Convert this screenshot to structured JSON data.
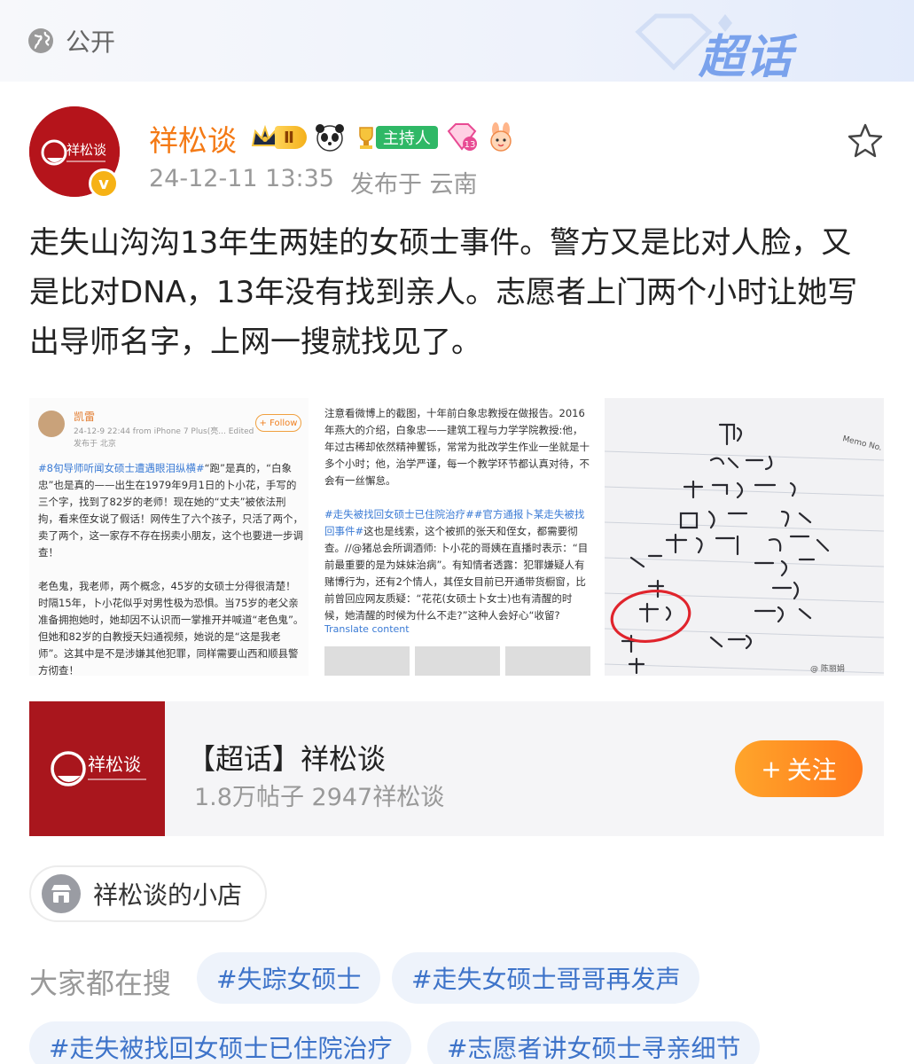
{
  "header": {
    "visibility_label": "公开",
    "supertopic_brand": "超话"
  },
  "author": {
    "name": "祥松谈",
    "level_badge": "Ⅱ",
    "host_badge": "主持人",
    "gem_level": "13",
    "timestamp": "24-12-11 13:35",
    "published_from": "发布于 云南",
    "avatar_text": "祥松谈"
  },
  "post": {
    "text": "走失山沟沟13年生两娃的女硕士事件。警方又是比对人脸，又是比对DNA，13年没有找到亲人。志愿者上门两个小时让她写出导师名字，上网一搜就找见了。"
  },
  "images": {
    "img1": {
      "name": "凯雷",
      "time": "24-12-9 22:44  from iPhone 7 Plus(亮...  Edited",
      "location": "发布于 北京",
      "follow_label": "+ Follow",
      "tag": "#8旬导师听闻女硕士遭遇眼泪纵横#",
      "para1": "“跑”是真的，“白象忠”也是真的——出生在1979年9月1日的卜小花，手写的三个字，找到了82岁的老师！现在她的“丈夫”被依法刑拘，看来侄女说了假话！网传生了六个孩子，只活了两个，卖了两个，这一家存不存在拐卖小朋友，这个也要进一步调查！",
      "para2": "老色鬼，我老师，两个概念，45岁的女硕士分得很清楚！时隔15年，卜小花似乎对男性极为恐惧。当75岁的老父亲准备拥抱她时，她却因不认识而一掌推开并喊道“老色鬼”。但她和82岁的白教授天妇通视频，她说的是“这是我老师”。这其中是不是涉嫌其他犯罪，同样需要山西和顺县警方彻查！"
    },
    "img2": {
      "para1": "注意看微博上的截图，十年前白象忠教授在做报告。2016年燕大的介绍，白象忠——建筑工程与力学学院教授:他，年过古稀却依然精神矍铄，常常为批改学生作业一坐就是十多个小时；他，治学严谨，每一个教学环节都认真对待，不会有一丝懈怠。",
      "tags": "#走失被找回女硕士已住院治疗##官方通报卜某走失被找回事件#",
      "para2": "这也是线索，这个被抓的张天和侄女，都需要彻查。//@猪总会所调酒师: 卜小花的哥姨在直播时表示：“目前最重要的是为妹妹治病”。有知情者透露：犯罪嫌疑人有赌博行为，还有2个情人，其侄女目前已开通带货橱窗，比前曾回应网友质疑：“花花(女硕士卜女士)也有清醒的时候，她清醒的时候为什么不走?”这种人会好心“收留?",
      "translate": "Translate content"
    },
    "img3": {
      "note_label": "Memo No. Date",
      "watermark": "@ 陈丽娟"
    }
  },
  "topic_card": {
    "title": "【超话】祥松谈",
    "stats": "1.8万帖子  2947祥松谈",
    "follow_label": "关注",
    "follow_plus": "+"
  },
  "shop": {
    "label": "祥松谈的小店"
  },
  "trending": {
    "label": "大家都在搜",
    "chips": [
      "#失踪女硕士",
      "#走失女硕士哥哥再发声",
      "#走失被找回女硕士已住院治疗",
      "#志愿者讲女硕士寻亲细节"
    ]
  },
  "colors": {
    "author_name": "#f47a16",
    "follow_button": "#ff8c22",
    "chip_text": "#3d73c9",
    "brand_red": "#a9161d"
  }
}
